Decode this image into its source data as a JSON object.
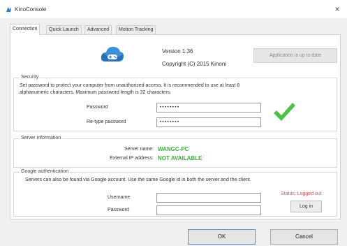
{
  "window": {
    "title": "KinoConsole",
    "close_symbol": "×",
    "icon": "app-icon"
  },
  "tabs": [
    {
      "label": "Connection",
      "active": true
    },
    {
      "label": "Quick Launch",
      "active": false
    },
    {
      "label": "Advanced",
      "active": false
    },
    {
      "label": "Motion Tracking",
      "active": false
    }
  ],
  "about": {
    "logo": "cloud-gamepad-logo",
    "version": "Version 1.36",
    "copyright": "Copyright (C) 2015 Kinoni",
    "update_button": "Application is up to date"
  },
  "security": {
    "label": "Security",
    "description_line1": "Set password to protect your computer from unauthorized access. It is recommended to use at least 8",
    "description_line2": "alphanumeric characters. Maximum password length is 32 characters.",
    "password_label": "Password",
    "password_value": "••••••••",
    "retype_label": "Re-type password",
    "retype_value": "••••••••",
    "match_icon": "checkmark-icon",
    "match_color": "#4cc24c"
  },
  "server": {
    "label": "Server information",
    "name_label": "Server name:",
    "name_value": "WANGC-PC",
    "ip_label": "External IP address:",
    "ip_value": "NOT AVAILABLE",
    "value_color": "#3fae3f"
  },
  "google": {
    "label": "Google authentication",
    "description": "Servers can also be found via Google account. Use the same Google id in both the server and the client.",
    "username_label": "Username",
    "username_value": "",
    "password_label": "Password",
    "password_value": "",
    "status": "Status: Logged out",
    "status_color": "#d9534f",
    "login_button": "Log in"
  },
  "footer": {
    "ok_button": "OK",
    "cancel_button": "Cancel"
  }
}
